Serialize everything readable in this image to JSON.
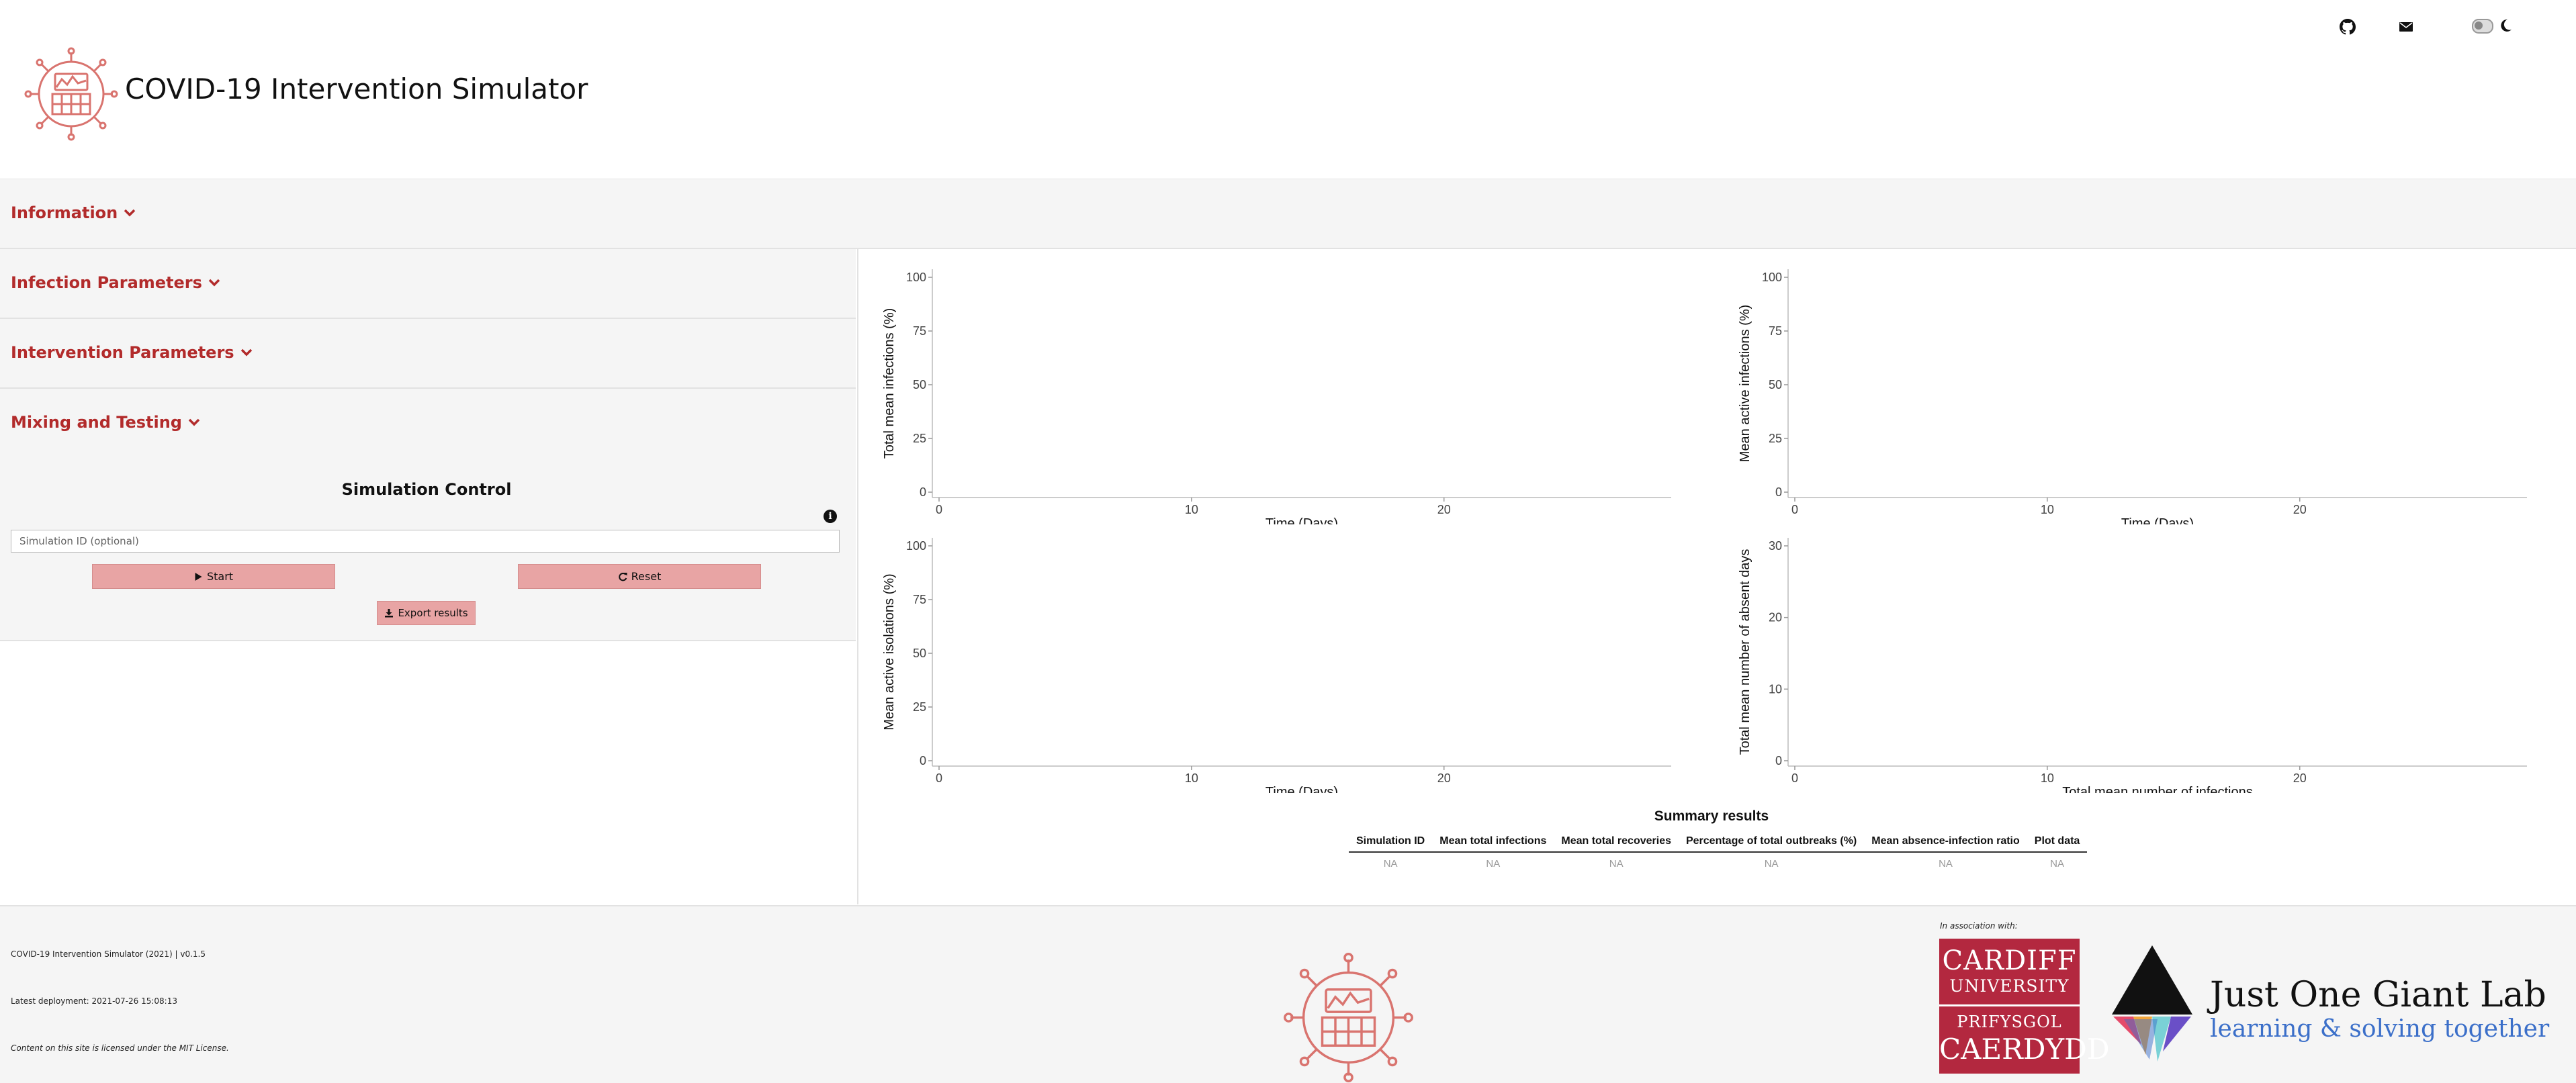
{
  "header": {
    "title": "COVID-19 Intervention Simulator",
    "icons": [
      "github-icon",
      "mail-icon",
      "theme-toggle",
      "moon-icon"
    ]
  },
  "accordion": {
    "information": "Information",
    "infection_parameters": "Infection Parameters",
    "intervention_parameters": "Intervention Parameters",
    "mixing_testing": "Mixing and Testing"
  },
  "simulation_control": {
    "title": "Simulation Control",
    "info_icon": "i",
    "input_placeholder": "Simulation ID (optional)",
    "start_label": "Start",
    "reset_label": "Reset",
    "export_label": "Export results"
  },
  "chart_data": [
    {
      "type": "line",
      "xlabel": "Time (Days)",
      "ylabel": "Total mean infections (%)",
      "xticks": [
        "0",
        "10",
        "20"
      ],
      "yticks": [
        "100",
        "75",
        "50",
        "25",
        "0"
      ],
      "xlim": [
        0,
        29
      ],
      "ylim": [
        0,
        100
      ],
      "series": []
    },
    {
      "type": "line",
      "xlabel": "Time (Days)",
      "ylabel": "Mean active infections (%)",
      "xticks": [
        "0",
        "10",
        "20"
      ],
      "yticks": [
        "100",
        "75",
        "50",
        "25",
        "0"
      ],
      "xlim": [
        0,
        29
      ],
      "ylim": [
        0,
        100
      ],
      "series": []
    },
    {
      "type": "line",
      "xlabel": "Time (Days)",
      "ylabel": "Mean active isolations (%)",
      "xticks": [
        "0",
        "10",
        "20"
      ],
      "yticks": [
        "100",
        "75",
        "50",
        "25",
        "0"
      ],
      "xlim": [
        0,
        29
      ],
      "ylim": [
        0,
        100
      ],
      "series": []
    },
    {
      "type": "scatter",
      "xlabel": "Total mean number of infections",
      "ylabel": "Total mean number of absent days",
      "xticks": [
        "0",
        "10",
        "20"
      ],
      "yticks": [
        "30",
        "20",
        "10",
        "0"
      ],
      "xlim": [
        0,
        29
      ],
      "ylim": [
        0,
        30
      ],
      "series": []
    }
  ],
  "summary": {
    "title": "Summary results",
    "columns": [
      "Simulation ID",
      "Mean total infections",
      "Mean total recoveries",
      "Percentage of total outbreaks (%)",
      "Mean absence-infection ratio",
      "Plot data"
    ],
    "row": [
      "NA",
      "NA",
      "NA",
      "NA",
      "NA",
      "NA"
    ]
  },
  "footer": {
    "version": "COVID-19 Intervention Simulator (2021) | v0.1.5",
    "deployment": "Latest deployment: 2021-07-26 15:08:13",
    "license": "Content on this site is licensed under the MIT License.",
    "association": "In association with:",
    "cardiff": {
      "line1": "CARDIFF",
      "line2": "UNIVERSITY",
      "line3": "PRIFYSGOL",
      "line4": "CAERDYDD"
    },
    "jogl_title": "Just One Giant Lab",
    "jogl_tagline": "learning & solving together"
  },
  "colors": {
    "accent": "#b22b2b",
    "button": "#e8a4a4",
    "panel": "#f5f5f5",
    "cardiff_red": "#b3283f",
    "jogl_blue": "#3b6fc9"
  }
}
